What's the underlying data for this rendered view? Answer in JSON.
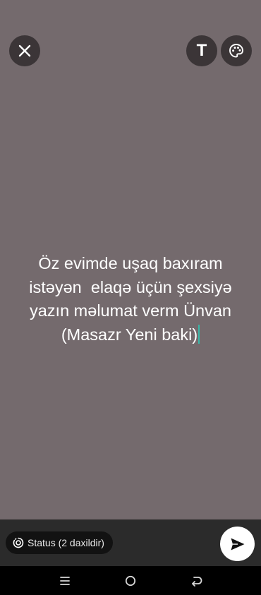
{
  "top_bar": {
    "close_icon": "close-icon",
    "text_button_label": "T",
    "palette_icon": "palette-icon"
  },
  "status_text": "Öz evimde uşaq baxıram\nistəyən  elaqə üçün şexsiyə\nyazın məlumat verm Ünvan\n(Masazr Yeni baki)",
  "bottom_bar": {
    "status_chip_label": "Status (2 daxildir)",
    "status_icon": "status-ring-icon",
    "send_icon": "send-icon"
  },
  "nav": {
    "recents_icon": "recents-icon",
    "home_icon": "home-icon",
    "back_icon": "back-icon"
  },
  "colors": {
    "background": "#746a6d",
    "button_bg": "#3b3537",
    "caret": "#3ab7a8",
    "bottom_bar": "#2b2b2b",
    "chip_bg": "#121212"
  }
}
